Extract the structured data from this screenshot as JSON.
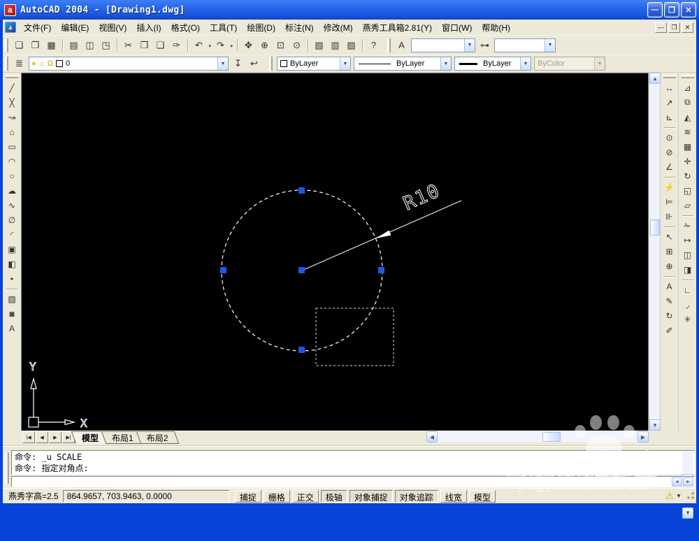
{
  "window": {
    "title": "AutoCAD 2004 - [Drawing1.dwg]",
    "app_icon_letter": "a",
    "controls": [
      {
        "name": "minimize-button",
        "glyph": "—"
      },
      {
        "name": "restore-button",
        "glyph": "❐"
      },
      {
        "name": "close-button",
        "glyph": "✕"
      }
    ]
  },
  "menubar": {
    "items": [
      {
        "name": "menu-file",
        "label": "文件(F)"
      },
      {
        "name": "menu-edit",
        "label": "编辑(E)"
      },
      {
        "name": "menu-view",
        "label": "视图(V)"
      },
      {
        "name": "menu-insert",
        "label": "插入(I)"
      },
      {
        "name": "menu-format",
        "label": "格式(O)"
      },
      {
        "name": "menu-tools",
        "label": "工具(T)"
      },
      {
        "name": "menu-draw",
        "label": "绘图(D)"
      },
      {
        "name": "menu-dimension",
        "label": "标注(N)"
      },
      {
        "name": "menu-modify",
        "label": "修改(M)"
      },
      {
        "name": "menu-yanxiu-toolbox",
        "label": "燕秀工具箱2.81(Y)"
      },
      {
        "name": "menu-window",
        "label": "窗口(W)"
      },
      {
        "name": "menu-help",
        "label": "帮助(H)"
      }
    ],
    "mdi_controls": [
      {
        "name": "mdi-minimize-button",
        "glyph": "—"
      },
      {
        "name": "mdi-restore-button",
        "glyph": "❐"
      },
      {
        "name": "mdi-close-button",
        "glyph": "✕"
      }
    ]
  },
  "toolbars": {
    "standard": [
      {
        "name": "new-file-icon",
        "glyph": "❏",
        "cls": ""
      },
      {
        "name": "open-icon",
        "glyph": "❐",
        "cls": ""
      },
      {
        "name": "save-icon",
        "glyph": "▦",
        "cls": ""
      },
      {
        "name": "print-icon",
        "glyph": "▤",
        "cls": "sep"
      },
      {
        "name": "print-preview-icon",
        "glyph": "◫",
        "cls": ""
      },
      {
        "name": "publish-icon",
        "glyph": "◳",
        "cls": ""
      },
      {
        "name": "cut-icon",
        "glyph": "✂",
        "cls": "sep"
      },
      {
        "name": "copy-clip-icon",
        "glyph": "❒",
        "cls": ""
      },
      {
        "name": "paste-icon",
        "glyph": "❑",
        "cls": ""
      },
      {
        "name": "match-properties-icon",
        "glyph": "✑",
        "cls": ""
      },
      {
        "name": "undo-icon",
        "glyph": "↶",
        "cls": "sep dd"
      },
      {
        "name": "redo-icon",
        "glyph": "↷",
        "cls": "dd"
      },
      {
        "name": "pan-icon",
        "glyph": "✥",
        "cls": "sep"
      },
      {
        "name": "zoom-realtime-icon",
        "glyph": "⊕",
        "cls": ""
      },
      {
        "name": "zoom-window-icon",
        "glyph": "⊡",
        "cls": ""
      },
      {
        "name": "zoom-previous-icon",
        "glyph": "⊙",
        "cls": ""
      },
      {
        "name": "properties-icon",
        "glyph": "▧",
        "cls": "sep"
      },
      {
        "name": "designcenter-icon",
        "glyph": "▥",
        "cls": ""
      },
      {
        "name": "tool-palettes-icon",
        "glyph": "▨",
        "cls": ""
      },
      {
        "name": "help-icon",
        "glyph": "?",
        "cls": "sep"
      }
    ],
    "styles": {
      "text_style_value": "",
      "dim_style_value": ""
    },
    "layers": {
      "current_layer": "0",
      "color_swatch": "#FFFFFF"
    },
    "properties": {
      "color": "ByLayer",
      "linetype": "ByLayer",
      "lineweight": "ByLayer",
      "plot_style": "ByColor"
    }
  },
  "draw_toolbar": [
    {
      "name": "line-icon",
      "glyph": "╱",
      "cls": ""
    },
    {
      "name": "construction-line-icon",
      "glyph": "╳",
      "cls": ""
    },
    {
      "name": "polyline-icon",
      "glyph": "↝",
      "cls": ""
    },
    {
      "name": "polygon-icon",
      "glyph": "⌂",
      "cls": ""
    },
    {
      "name": "rectangle-icon",
      "glyph": "▭",
      "cls": ""
    },
    {
      "name": "arc-icon",
      "glyph": "◠",
      "cls": ""
    },
    {
      "name": "circle-icon",
      "glyph": "○",
      "cls": ""
    },
    {
      "name": "revision-cloud-icon",
      "glyph": "☁",
      "cls": ""
    },
    {
      "name": "spline-icon",
      "glyph": "∿",
      "cls": ""
    },
    {
      "name": "ellipse-icon",
      "glyph": "∅",
      "cls": ""
    },
    {
      "name": "ellipse-arc-icon",
      "glyph": "◜",
      "cls": ""
    },
    {
      "name": "insert-block-icon",
      "glyph": "▣",
      "cls": ""
    },
    {
      "name": "make-block-icon",
      "glyph": "◧",
      "cls": ""
    },
    {
      "name": "point-icon",
      "glyph": "•",
      "cls": ""
    },
    {
      "name": "hatch-icon",
      "glyph": "▨",
      "cls": "vsep"
    },
    {
      "name": "region-icon",
      "glyph": "◙",
      "cls": ""
    },
    {
      "name": "mtext-icon",
      "glyph": "A",
      "cls": ""
    }
  ],
  "dimension_toolbar": [
    {
      "name": "linear-dimension-icon",
      "glyph": "↔",
      "cls": ""
    },
    {
      "name": "aligned-dimension-icon",
      "glyph": "↗",
      "cls": ""
    },
    {
      "name": "ordinate-dimension-icon",
      "glyph": "⊾",
      "cls": ""
    },
    {
      "name": "radius-dimension-icon",
      "glyph": "⊙",
      "cls": "vsep"
    },
    {
      "name": "diameter-dimension-icon",
      "glyph": "⊘",
      "cls": ""
    },
    {
      "name": "angular-dimension-icon",
      "glyph": "∠",
      "cls": ""
    },
    {
      "name": "quick-dimension-icon",
      "glyph": "⚡",
      "cls": "vsep"
    },
    {
      "name": "baseline-dimension-icon",
      "glyph": "⊨",
      "cls": ""
    },
    {
      "name": "continue-dimension-icon",
      "glyph": "⊪",
      "cls": ""
    },
    {
      "name": "quick-leader-icon",
      "glyph": "↖",
      "cls": "vsep"
    },
    {
      "name": "tolerance-icon",
      "glyph": "⊞",
      "cls": ""
    },
    {
      "name": "center-mark-icon",
      "glyph": "⊕",
      "cls": ""
    },
    {
      "name": "dimension-edit-icon",
      "glyph": "A",
      "cls": "vsep"
    },
    {
      "name": "dimension-text-edit-icon",
      "glyph": "✎",
      "cls": ""
    },
    {
      "name": "dimension-update-icon",
      "glyph": "↻",
      "cls": ""
    },
    {
      "name": "dimension-style-icon",
      "glyph": "✐",
      "cls": ""
    }
  ],
  "modify_toolbar": [
    {
      "name": "erase-icon",
      "glyph": "⊿",
      "cls": ""
    },
    {
      "name": "copy-icon",
      "glyph": "⧉",
      "cls": ""
    },
    {
      "name": "mirror-icon",
      "glyph": "◭",
      "cls": ""
    },
    {
      "name": "offset-icon",
      "glyph": "≋",
      "cls": ""
    },
    {
      "name": "array-icon",
      "glyph": "▦",
      "cls": ""
    },
    {
      "name": "move-icon",
      "glyph": "✛",
      "cls": ""
    },
    {
      "name": "rotate-icon",
      "glyph": "↻",
      "cls": ""
    },
    {
      "name": "scale-icon",
      "glyph": "◱",
      "cls": ""
    },
    {
      "name": "stretch-icon",
      "glyph": "▱",
      "cls": ""
    },
    {
      "name": "trim-icon",
      "glyph": "✁",
      "cls": "vsep"
    },
    {
      "name": "extend-icon",
      "glyph": "↦",
      "cls": ""
    },
    {
      "name": "break-at-point-icon",
      "glyph": "◫",
      "cls": ""
    },
    {
      "name": "break-icon",
      "glyph": "◨",
      "cls": ""
    },
    {
      "name": "chamfer-icon",
      "glyph": "∟",
      "cls": "vsep"
    },
    {
      "name": "fillet-icon",
      "glyph": "◞",
      "cls": ""
    },
    {
      "name": "explode-icon",
      "glyph": "✳",
      "cls": ""
    }
  ],
  "canvas": {
    "radius_label": "R10",
    "ucs_x_label": "X",
    "ucs_y_label": "Y",
    "grip_color": "#1E56E8",
    "entity_color": "#FFFFFF",
    "background": "#000000"
  },
  "tabs": {
    "nav": [
      {
        "name": "tab-nav-first",
        "glyph": "|◀"
      },
      {
        "name": "tab-nav-prev",
        "glyph": "◀"
      },
      {
        "name": "tab-nav-next",
        "glyph": "▶"
      },
      {
        "name": "tab-nav-last",
        "glyph": "▶|"
      }
    ],
    "items": [
      {
        "name": "tab-model",
        "label": "模型",
        "cls": "active"
      },
      {
        "name": "tab-layout1",
        "label": "布局1",
        "cls": ""
      },
      {
        "name": "tab-layout2",
        "label": "布局2",
        "cls": ""
      }
    ]
  },
  "command": {
    "history": [
      "命令: _u SCALE",
      "命令: 指定对角点:"
    ],
    "prompt": "命令: 指定对角点:"
  },
  "statusbar": {
    "left_text": "燕秀字高=2.5",
    "coordinates": "864.9657, 703.9463, 0.0000",
    "toggles": [
      {
        "name": "toggle-snap",
        "label": "捕捉",
        "cls": ""
      },
      {
        "name": "toggle-grid",
        "label": "栅格",
        "cls": ""
      },
      {
        "name": "toggle-ortho",
        "label": "正交",
        "cls": ""
      },
      {
        "name": "toggle-polar",
        "label": "极轴",
        "cls": "pressed"
      },
      {
        "name": "toggle-osnap",
        "label": "对象捕捉",
        "cls": "pressed"
      },
      {
        "name": "toggle-otrack",
        "label": "对象追踪",
        "cls": "pressed"
      },
      {
        "name": "toggle-lineweight",
        "label": "线宽",
        "cls": ""
      },
      {
        "name": "toggle-model",
        "label": "模型",
        "cls": ""
      }
    ]
  },
  "watermark": {
    "brand": "Baidu",
    "suffix": "经验",
    "url": "jingyan.baidu.com"
  }
}
